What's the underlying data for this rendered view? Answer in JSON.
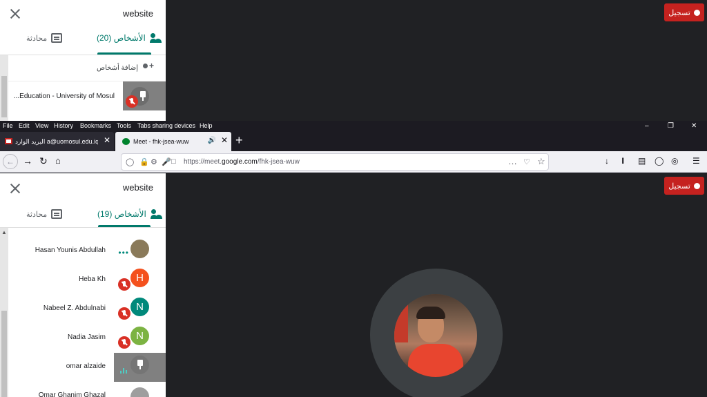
{
  "top_panel": {
    "title": "website",
    "tabs": {
      "people_label": "الأشخاص (20)",
      "chat_label": "محادثة"
    },
    "add_people_label": "إضافة أشخاص",
    "participants": [
      {
        "name": "...Education - University of Mosul"
      }
    ]
  },
  "record_button": {
    "label": "تسجيل"
  },
  "menubar": {
    "items": [
      "File",
      "Edit",
      "View",
      "History",
      "Bookmarks",
      "Tools",
      "Tabs sharing devices",
      "Help"
    ]
  },
  "tabs": [
    {
      "title": "البريد الوارد a@uomosul.edu.iq",
      "icon": "gmail-icon"
    },
    {
      "title": "Meet - fhk-jsea-wuw",
      "icon": "meet-icon"
    }
  ],
  "urlbar": {
    "url_prefix": "https://meet.",
    "url_domain": "google.com",
    "url_path": "/fhk-jsea-wuw"
  },
  "bottom_panel": {
    "title": "website",
    "tabs": {
      "people_label": "الأشخاص (19)",
      "chat_label": "محادثة"
    },
    "participants": [
      {
        "name": "Hasan Younis Abdullah",
        "avatar_initial": "",
        "avatar_color": "#8a7a5a",
        "status": "speaking-dots"
      },
      {
        "name": "Heba Kh",
        "avatar_initial": "H",
        "avatar_color": "#f4511e",
        "status": "muted"
      },
      {
        "name": "Nabeel Z. Abdulnabi",
        "avatar_initial": "N",
        "avatar_color": "#00897b",
        "status": "muted"
      },
      {
        "name": "Nadia Jasim",
        "avatar_initial": "N",
        "avatar_color": "#7cb342",
        "status": "muted"
      },
      {
        "name": "omar alzaide",
        "avatar_initial": "",
        "avatar_color": "#757575",
        "status": "speaking"
      },
      {
        "name": "Omar Ghanim Ghazal",
        "avatar_initial": "",
        "avatar_color": "#9e9e9e",
        "status": ""
      }
    ]
  },
  "colors": {
    "meet_green": "#00796b",
    "record_red": "#c5221f",
    "dark_bg": "#202124"
  }
}
